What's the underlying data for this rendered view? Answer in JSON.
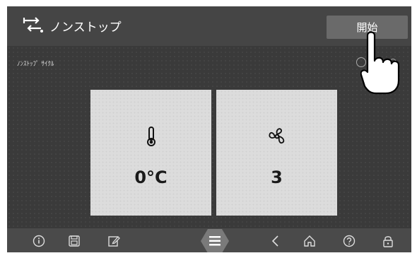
{
  "header": {
    "title": "ノンストップ",
    "start_button": "開始"
  },
  "main": {
    "cycle_label": "ﾉﾝｽﾄｯﾌﾟ ｻｲｸﾙ",
    "tiles": [
      {
        "icon": "thermometer-icon",
        "value": "0°C"
      },
      {
        "icon": "fan-icon",
        "value": "3"
      }
    ]
  },
  "footer": {
    "icons": [
      "info-icon",
      "save-icon",
      "edit-icon",
      "menu-icon",
      "back-icon",
      "home-icon",
      "help-icon",
      "lock-icon"
    ]
  },
  "colors": {
    "background": "#3f3f3f",
    "header": "#454545",
    "tile": "#dcdcdc",
    "button": "#6a6a6a",
    "menu_accent": "#7a7a7a"
  }
}
